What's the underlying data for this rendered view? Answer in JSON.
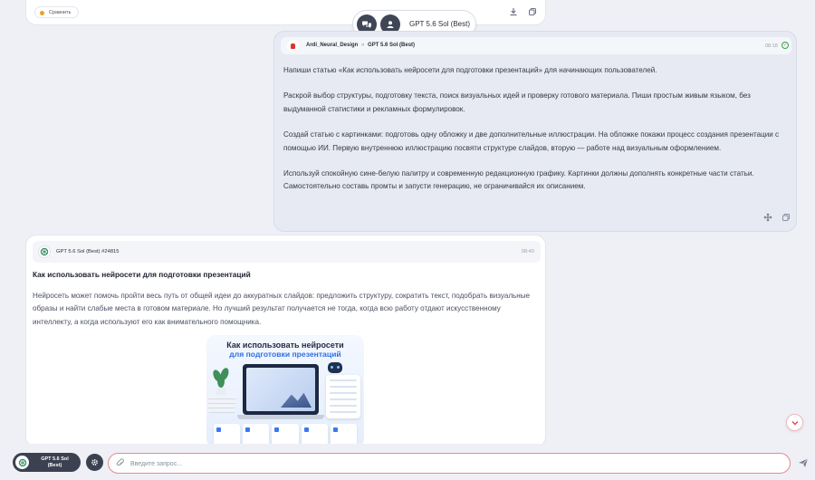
{
  "top_card": {
    "badge": "Сравнить"
  },
  "model_pill": {
    "label": "GPT 5.6 Sol (Best)"
  },
  "user_message": {
    "author": "Ardi_Neural_Design",
    "separator": "»",
    "model": "GPT 5.6 Sol (Best)",
    "time": "08:18",
    "paragraphs": [
      "Напиши статью «Как использовать нейросети для подготовки презентаций» для начинающих пользователей.",
      "Раскрой выбор структуры, подготовку текста, поиск визуальных идей и проверку готового материала. Пиши простым живым языком, без выдуманной статистики и рекламных формулировок.",
      "Создай статью с картинками: подготовь одну обложку и две дополнительные иллюстрации. На обложке покажи процесс создания презентации с помощью ИИ. Первую внутреннюю иллюстрацию посвяти структуре слайдов, вторую — работе над визуальным оформлением.",
      "Используй спокойную сине-белую палитру и современную редакционную графику. Картинки должны дополнять конкретные части статьи. Самостоятельно составь промты и запусти генерацию, не ограничивайся их описанием."
    ]
  },
  "ai_message": {
    "header": "GPT 5.6 Sol (Best) #24815",
    "time": "08:40",
    "title": "Как использовать нейросети для подготовки презентаций",
    "body": "Нейросеть может помочь пройти весь путь от общей идеи до аккуратных слайдов: предложить структуру, сократить текст, подобрать визуальные образы и найти слабые места в готовом материале. Но лучший результат получается не тогда, когда всю работу отдают искусственному интеллекту, а когда используют его как внимательного помощника.",
    "illustration": {
      "title_line1": "Как использовать нейросети",
      "title_line2": "для подготовки презентаций"
    }
  },
  "bottom_bar": {
    "model_line1": "GPT 5.6 Sol",
    "model_line2": "(Best)",
    "input_placeholder": "Введите запрос..."
  },
  "colors": {
    "accent": "#2f6fe6",
    "danger": "#e04848",
    "dark": "#3b4150",
    "success": "#2ea44f"
  }
}
